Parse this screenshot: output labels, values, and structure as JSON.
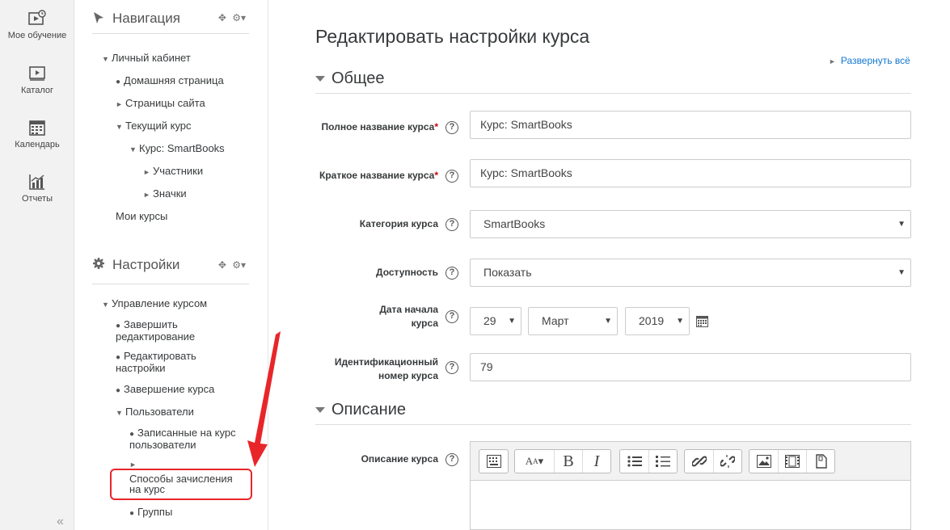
{
  "rail": {
    "items": [
      {
        "label": "Мое обучение",
        "icon": "my-learning-icon"
      },
      {
        "label": "Каталог",
        "icon": "catalog-icon"
      },
      {
        "label": "Календарь",
        "icon": "calendar-icon"
      },
      {
        "label": "Отчеты",
        "icon": "reports-icon"
      }
    ],
    "collapse": "«"
  },
  "navigation": {
    "title": "Навигация",
    "items": {
      "dashboard": "Личный кабинет",
      "home": "Домашняя страница",
      "site_pages": "Страницы сайта",
      "current_course": "Текущий курс",
      "course": "Курс: SmartBooks",
      "participants": "Участники",
      "badges": "Значки",
      "my_courses": "Мои курсы"
    }
  },
  "settings": {
    "title": "Настройки",
    "items": {
      "course_admin": "Управление курсом",
      "finish_editing": "Завершить редактирование",
      "edit_settings": "Редактировать настройки",
      "course_completion": "Завершение курса",
      "users": "Пользователи",
      "enrolled_users": "Записанные на курс пользователи",
      "enrolment_methods": "Способы зачисления на курс",
      "groups": "Группы"
    }
  },
  "main": {
    "title": "Редактировать настройки курса",
    "expand_all": "Развернуть всё",
    "sections": {
      "general": "Общее",
      "description": "Описание"
    },
    "fields": {
      "fullname_label": "Полное название курса",
      "fullname_value": "Курс: SmartBooks",
      "shortname_label": "Краткое название курса",
      "shortname_value": "Курс: SmartBooks",
      "category_label": "Категория курса",
      "category_value": "SmartBooks",
      "visibility_label": "Доступность",
      "visibility_value": "Показать",
      "startdate_label_1": "Дата начала",
      "startdate_label_2": "курса",
      "startdate_day": "29",
      "startdate_month": "Март",
      "startdate_year": "2019",
      "idnumber_label_1": "Идентификационный",
      "idnumber_label_2": "номер курса",
      "idnumber_value": "79",
      "summary_label": "Описание курса"
    },
    "required_mark": "*",
    "help_mark": "?"
  },
  "colors": {
    "accent": "#1177d1",
    "highlight": "#e8262a"
  }
}
